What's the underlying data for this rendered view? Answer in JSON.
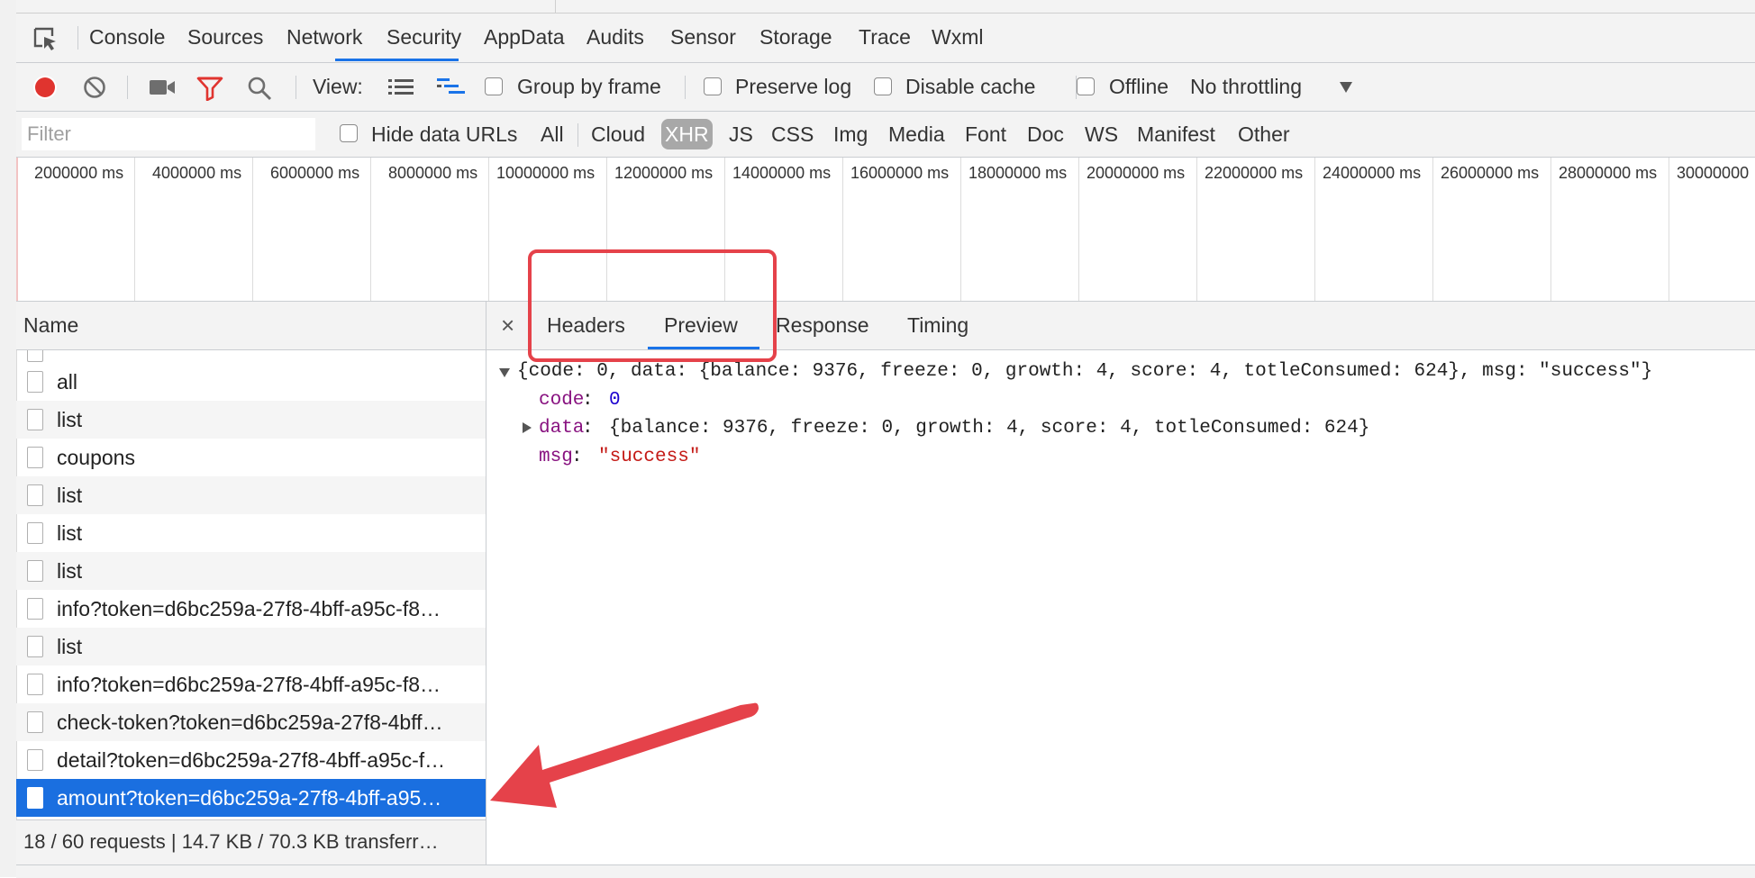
{
  "devtools": {
    "tabs": [
      "Console",
      "Sources",
      "Network",
      "Security",
      "AppData",
      "Audits",
      "Sensor",
      "Storage",
      "Trace",
      "Wxml"
    ],
    "active_tab": "Network"
  },
  "toolbar": {
    "view_label": "View:",
    "group_by_frame": "Group by frame",
    "preserve_log": "Preserve log",
    "disable_cache": "Disable cache",
    "offline": "Offline",
    "throttling": "No throttling",
    "record_color": "#e0342f"
  },
  "filter": {
    "placeholder": "Filter",
    "hide_data_urls": "Hide data URLs",
    "types": [
      "All",
      "Cloud",
      "XHR",
      "JS",
      "CSS",
      "Img",
      "Media",
      "Font",
      "Doc",
      "WS",
      "Manifest",
      "Other"
    ],
    "active_type": "XHR"
  },
  "timeline": {
    "ticks": [
      "2000000 ms",
      "4000000 ms",
      "6000000 ms",
      "8000000 ms",
      "10000000 ms",
      "12000000 ms",
      "14000000 ms",
      "16000000 ms",
      "18000000 ms",
      "20000000 ms",
      "22000000 ms",
      "24000000 ms",
      "26000000 ms",
      "28000000 ms",
      "30000000"
    ]
  },
  "requests": {
    "header": "Name",
    "items": [
      "all",
      "list",
      "coupons",
      "list",
      "list",
      "list",
      "info?token=d6bc259a-27f8-4bff-a95c-f8…",
      "list",
      "info?token=d6bc259a-27f8-4bff-a95c-f8…",
      "check-token?token=d6bc259a-27f8-4bff…",
      "detail?token=d6bc259a-27f8-4bff-a95c-f…",
      "amount?token=d6bc259a-27f8-4bff-a95…"
    ],
    "selected_index": 11,
    "status": "18 / 60 requests | 14.7 KB / 70.3 KB transferr…"
  },
  "details": {
    "close": "×",
    "tabs": [
      "Headers",
      "Preview",
      "Response",
      "Timing"
    ],
    "active_tab": "Preview",
    "preview": {
      "summary": "{code: 0, data: {balance: 9376, freeze: 0, growth: 4, score: 4, totleConsumed: 624}, msg: \"success\"}",
      "code_key": "code",
      "code_val": "0",
      "data_key": "data",
      "data_val": "{balance: 9376, freeze: 0, growth: 4, score: 4, totleConsumed: 624}",
      "msg_key": "msg",
      "msg_val": "\"success\""
    }
  },
  "annotation_color": "#e5424a"
}
